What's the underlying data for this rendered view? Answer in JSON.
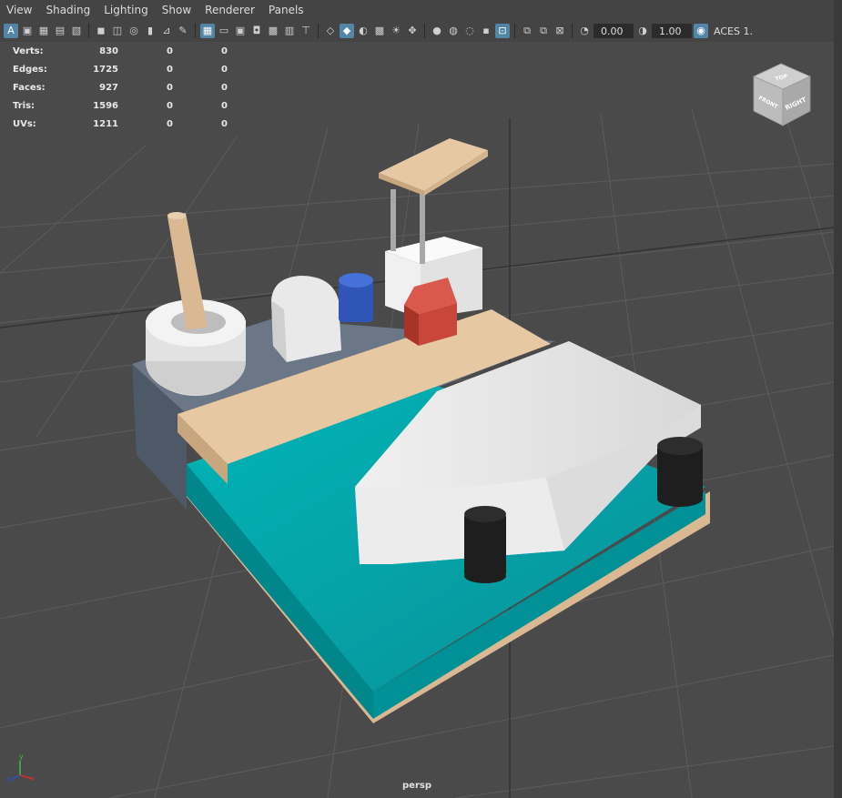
{
  "menu": [
    "View",
    "Shading",
    "Lighting",
    "Show",
    "Renderer",
    "Panels"
  ],
  "toolbar": {
    "exposure_value": "0.00",
    "gamma_value": "1.00",
    "colorspace_label": "ACES 1.",
    "icons": [
      "select-camera-icon",
      "camera-attributes-icon",
      "bookmark-icon",
      "image-plane-icon",
      "grid-icon",
      "film-gate-icon",
      "resolution-gate-icon",
      "gate-mask-icon",
      "field-chart-icon",
      "safe-action-icon",
      "safe-title-icon",
      "wireframe-icon",
      "smooth-shade-icon",
      "default-material-icon",
      "textured-icon",
      "use-lights-icon",
      "shadows-icon",
      "ambient-occlusion-icon",
      "motion-blur-icon",
      "anti-aliasing-icon",
      "depth-of-field-icon",
      "isolate-select-icon",
      "xray-icon",
      "xray-joints-icon",
      "xray-components-icon",
      "exposure-icon",
      "gamma-icon",
      "color-management-icon"
    ]
  },
  "hud": {
    "rows": [
      {
        "label": "Verts:",
        "v1": "830",
        "v2": "0",
        "v3": "0"
      },
      {
        "label": "Edges:",
        "v1": "1725",
        "v2": "0",
        "v3": "0"
      },
      {
        "label": "Faces:",
        "v1": "927",
        "v2": "0",
        "v3": "0"
      },
      {
        "label": "Tris:",
        "v1": "1596",
        "v2": "0",
        "v3": "0"
      },
      {
        "label": "UVs:",
        "v1": "1211",
        "v2": "0",
        "v3": "0"
      }
    ]
  },
  "viewcube": {
    "top_label": "TOP",
    "front_label": "FRONT",
    "right_label": "RIGHT"
  },
  "axis": {
    "y": "y",
    "x": "x",
    "z": "z"
  },
  "camera_label": "persp",
  "colors": {
    "viewport_bg": "#4a4a4a",
    "water": "#00a2a8",
    "wood": "#e6c8a2",
    "boat": "#e8e8e8",
    "bollard": "#1e1e1e",
    "base_block": "#6b7686",
    "red_box": "#c8463a",
    "blue_can": "#2f55b8"
  }
}
